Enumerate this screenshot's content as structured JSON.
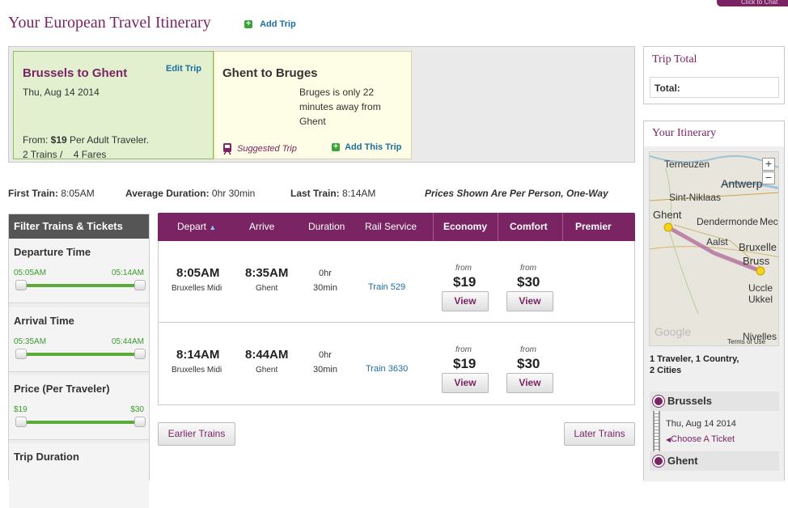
{
  "corner_tab": "Click to Chat",
  "page_title": "Your European Travel Itinerary",
  "add_trip": "Add Trip",
  "current_trip": {
    "title": "Brussels to Ghent",
    "edit": "Edit Trip",
    "date": "Thu, Aug 14 2014",
    "from_prefix": "From: ",
    "from_price": "$19",
    "from_suffix": " Per Adult Traveler.",
    "trains": "2 Trains /",
    "fares": "4 Fares"
  },
  "suggested_trip": {
    "title": "Ghent to Bruges",
    "description": "Bruges is only 22 minutes away from Ghent",
    "badge": "Suggested Trip",
    "add": "Add This Trip"
  },
  "stats": {
    "first_label": "First Train:",
    "first_value": "8:05AM",
    "avg_label": "Average Duration:",
    "avg_value": "0hr 30min",
    "last_label": "Last Train:",
    "last_value": "8:14AM",
    "note": "Prices Shown Are Per Person, One-Way"
  },
  "filters": {
    "header": "Filter Trains & Tickets",
    "sections": [
      {
        "label": "Departure Time",
        "min": "05:05AM",
        "max": "05:14AM"
      },
      {
        "label": "Arrival Time",
        "min": "05:35AM",
        "max": "05:44AM"
      },
      {
        "label": "Price (Per Traveler)",
        "min": "$19",
        "max": "$30"
      },
      {
        "label": "Trip Duration"
      }
    ]
  },
  "table": {
    "columns": [
      "Depart",
      "Arrive",
      "Duration",
      "Rail Service",
      "Economy",
      "Comfort",
      "Premier"
    ],
    "sort_indicator": "▲",
    "rows": [
      {
        "depart_time": "8:05AM",
        "depart_station": "Bruxelles Midi",
        "arrive_time": "8:35AM",
        "arrive_station": "Ghent",
        "duration_h": "0hr",
        "duration_m": "30min",
        "service": "Train 529",
        "economy_from": "from",
        "economy_price": "$19",
        "comfort_from": "from",
        "comfort_price": "$30",
        "view": "View"
      },
      {
        "depart_time": "8:14AM",
        "depart_station": "Bruxelles Midi",
        "arrive_time": "8:44AM",
        "arrive_station": "Ghent",
        "duration_h": "0hr",
        "duration_m": "30min",
        "service": "Train 3630",
        "economy_from": "from",
        "economy_price": "$19",
        "comfort_from": "from",
        "comfort_price": "$30",
        "view": "View"
      }
    ]
  },
  "earlier_trains": "Earlier Trains",
  "later_trains": "Later Trains",
  "trip_total": {
    "title": "Trip Total",
    "label": "Total:"
  },
  "itinerary": {
    "title": "Your Itinerary",
    "map_labels": [
      "Terneuzen",
      "Antwerp",
      "Sint-Niklaas",
      "Ghent",
      "Dendermonde",
      "Mech",
      "Aalst",
      "Bruxelle",
      "Bruss",
      "Uccle",
      "Ukkel",
      "Nivelles",
      "Google",
      "Terms of Use"
    ],
    "summary_line1": "1 Traveler, 1 Country,",
    "summary_line2": "2 Cities",
    "origin": "Brussels",
    "date": "Thu, Aug 14 2014",
    "choose": "Choose A Ticket",
    "destination": "Ghent"
  }
}
